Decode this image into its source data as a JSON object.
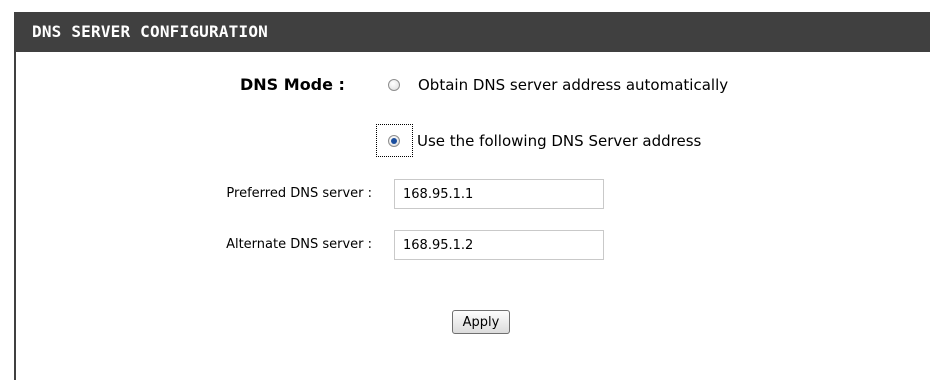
{
  "section": {
    "title": "DNS SERVER CONFIGURATION"
  },
  "dns_mode": {
    "label": "DNS Mode :",
    "options": [
      {
        "label": "Obtain DNS server address automatically",
        "selected": false
      },
      {
        "label": "Use the following DNS Server address",
        "selected": true
      }
    ]
  },
  "preferred": {
    "label": "Preferred DNS server :",
    "value": "168.95.1.1"
  },
  "alternate": {
    "label": "Alternate DNS server :",
    "value": "168.95.1.2"
  },
  "actions": {
    "apply_label": "Apply"
  }
}
